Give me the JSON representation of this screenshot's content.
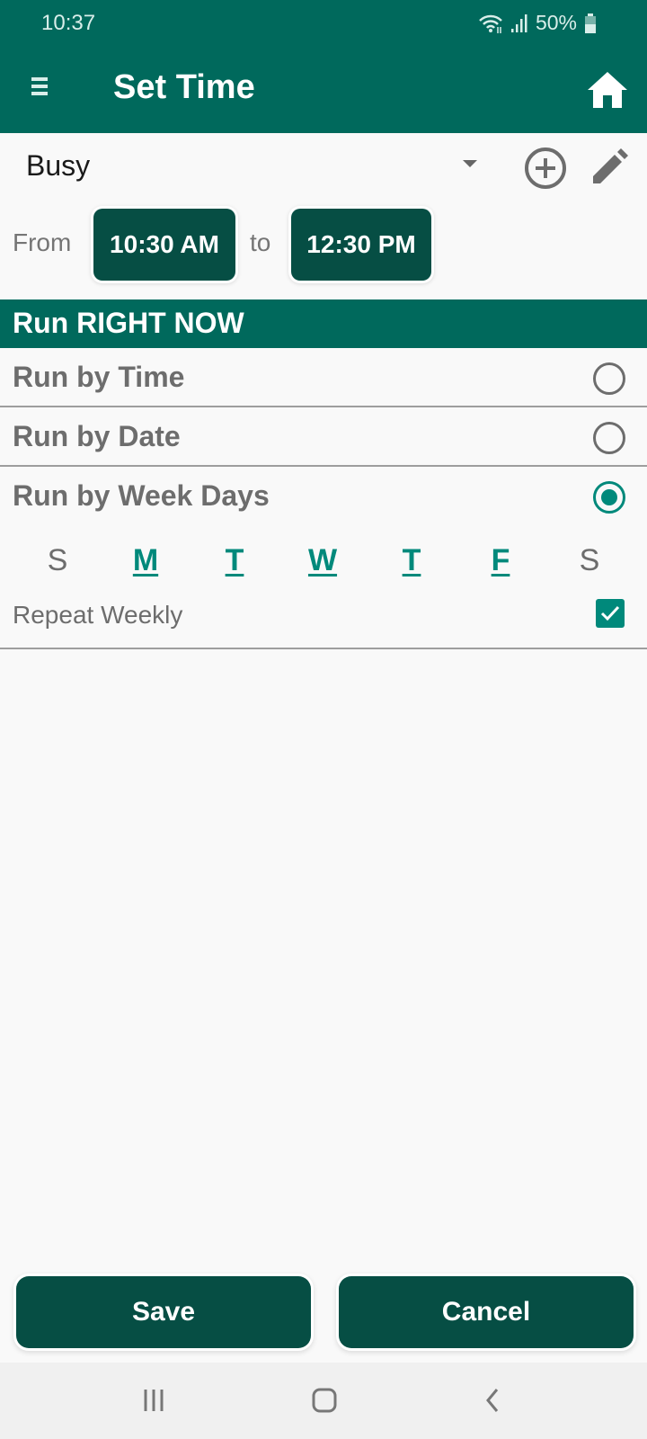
{
  "status_bar": {
    "time": "10:37",
    "battery": "50%",
    "icons": [
      "wifi-icon",
      "signal-icon",
      "battery-icon"
    ]
  },
  "app_bar": {
    "title": "Set Time",
    "menu_icon": "hamburger-menu-icon",
    "home_icon": "home-icon"
  },
  "profile": {
    "selected": "Busy",
    "add_icon": "add-circle-icon",
    "edit_icon": "pencil-icon"
  },
  "time_range": {
    "from_label": "From",
    "from_value": "10:30 AM",
    "to_label": "to",
    "to_value": "12:30 PM"
  },
  "section": {
    "header": "Run RIGHT NOW"
  },
  "run_options": [
    {
      "label": "Run by Time",
      "selected": false
    },
    {
      "label": "Run by Date",
      "selected": false
    },
    {
      "label": "Run by Week Days",
      "selected": true
    }
  ],
  "weekdays": [
    {
      "label": "S",
      "active": false
    },
    {
      "label": "M",
      "active": true
    },
    {
      "label": "T",
      "active": true
    },
    {
      "label": "W",
      "active": true
    },
    {
      "label": "T",
      "active": true
    },
    {
      "label": "F",
      "active": true
    },
    {
      "label": "S",
      "active": false
    }
  ],
  "repeat": {
    "label": "Repeat Weekly",
    "checked": true
  },
  "actions": {
    "save_label": "Save",
    "cancel_label": "Cancel"
  },
  "colors": {
    "primary": "#00695c",
    "button": "#064e44",
    "accent": "#00897b"
  }
}
